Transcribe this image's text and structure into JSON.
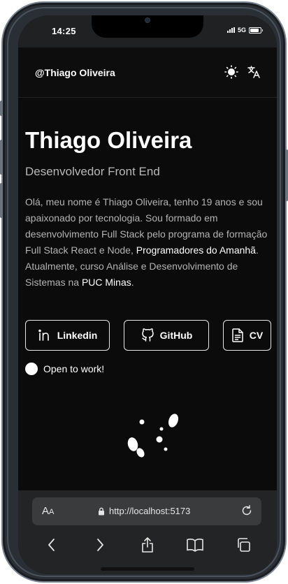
{
  "status": {
    "time": "14:25",
    "network": "5G",
    "battery_level": 0.85
  },
  "header": {
    "handle": "@Thiago Oliveira",
    "theme_icon": "sun-icon",
    "translate_icon": "translate-icon"
  },
  "profile": {
    "name": "Thiago Oliveira",
    "role": "Desenvolvedor Front End",
    "bio_part1": "Olá, meu nome é Thiago Oliveira, tenho 19 anos e sou apaixonado por tecnologia. Sou formado em desenvolvimento Full Stack pelo programa de formação Full Stack React e Node, ",
    "bio_link1": "Programadores do Amanhã",
    "bio_part2": ". Atualmente, curso Análise e Desenvolvimento de Sistemas na ",
    "bio_link2": "PUC Minas",
    "bio_part3": "."
  },
  "buttons": {
    "linkedin": "Linkedin",
    "github": "GitHub",
    "cv": "CV"
  },
  "availability": "Open to work!",
  "browser": {
    "text_size": "A",
    "text_size_small": "A",
    "url": "http://localhost:5173"
  },
  "colors": {
    "background": "#0b0b0b",
    "text": "#ffffff",
    "muted": "#b3b3b3"
  }
}
